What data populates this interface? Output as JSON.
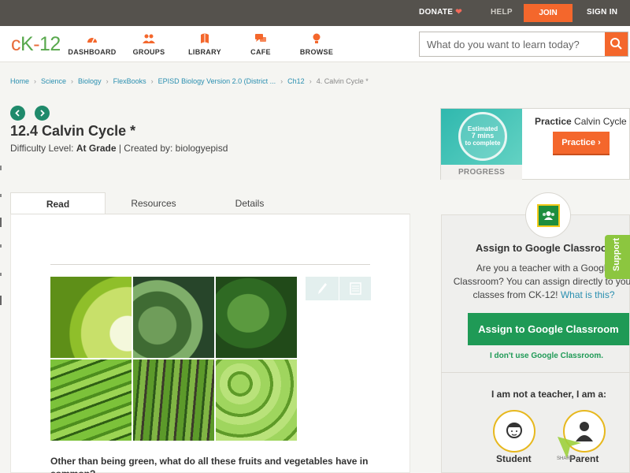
{
  "topbar": {
    "donate": "DONATE",
    "help": "HELP",
    "join": "JOIN",
    "signin": "SIGN IN"
  },
  "logo": {
    "c": "c",
    "k": "K",
    "dash": "-",
    "num": "12"
  },
  "nav": [
    {
      "label": "DASHBOARD",
      "icon": "dashboard-icon"
    },
    {
      "label": "GROUPS",
      "icon": "groups-icon"
    },
    {
      "label": "LIBRARY",
      "icon": "library-icon"
    },
    {
      "label": "CAFE",
      "icon": "cafe-icon"
    },
    {
      "label": "BROWSE",
      "icon": "browse-icon"
    }
  ],
  "search": {
    "placeholder": "What do you want to learn today?"
  },
  "breadcrumb": [
    "Home",
    "Science",
    "Biology",
    "FlexBooks",
    "EPISD Biology Version 2.0 (District ...",
    "Ch12",
    "4. Calvin Cycle *"
  ],
  "lesson": {
    "title": "12.4 Calvin Cycle *",
    "difficulty_label": "Difficulty Level:",
    "difficulty": "At Grade",
    "created_by": "| Created by: biologyepisd"
  },
  "tabs": [
    {
      "label": "Read"
    },
    {
      "label": "Resources"
    },
    {
      "label": "Details"
    }
  ],
  "content": {
    "question": "Other than being green, what do all these fruits and vegetables have in common?"
  },
  "practice": {
    "estimated": "Estimated",
    "mins": "7 mins",
    "to_complete": "to complete",
    "progress": "PROGRESS",
    "title_bold": "Practice",
    "title_rest": "Calvin Cycle",
    "button": "Practice"
  },
  "classroom": {
    "heading": "Assign to Google Classroom",
    "desc": "Are you a teacher with a Google Classroom? You can assign directly to your classes from CK-12!",
    "link": "What is this?",
    "button": "Assign to Google Classroom",
    "no": "I don't use Google Classroom.",
    "not_teacher": "I am not a teacher, I am a:",
    "student": "Student",
    "parent": "Parent"
  },
  "support": "Support",
  "share": "SHARE",
  "colors": {
    "accent": "#f4672c",
    "green": "#1f9a56",
    "teal": "#2fb8ae",
    "link": "#2a8fb0"
  }
}
